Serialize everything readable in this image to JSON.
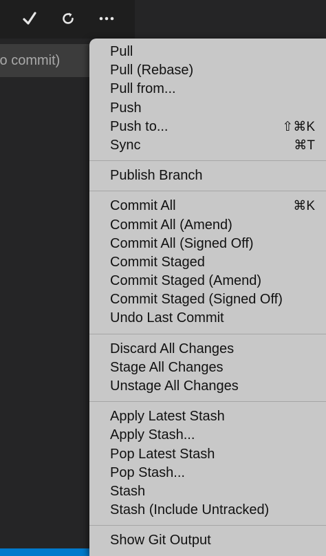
{
  "toolbar": {
    "commit_icon": "checkmark-icon",
    "refresh_icon": "refresh-icon",
    "more_icon": "ellipsis-icon"
  },
  "commit_input": {
    "placeholder_fragment": "to commit)"
  },
  "menu": {
    "groups": [
      {
        "items": [
          {
            "label": "Pull",
            "shortcut": ""
          },
          {
            "label": "Pull (Rebase)",
            "shortcut": ""
          },
          {
            "label": "Pull from...",
            "shortcut": ""
          },
          {
            "label": "Push",
            "shortcut": ""
          },
          {
            "label": "Push to...",
            "shortcut": "⇧⌘K"
          },
          {
            "label": "Sync",
            "shortcut": "⌘T"
          }
        ]
      },
      {
        "items": [
          {
            "label": "Publish Branch",
            "shortcut": ""
          }
        ]
      },
      {
        "items": [
          {
            "label": "Commit All",
            "shortcut": "⌘K"
          },
          {
            "label": "Commit All (Amend)",
            "shortcut": ""
          },
          {
            "label": "Commit All (Signed Off)",
            "shortcut": ""
          },
          {
            "label": "Commit Staged",
            "shortcut": ""
          },
          {
            "label": "Commit Staged (Amend)",
            "shortcut": ""
          },
          {
            "label": "Commit Staged (Signed Off)",
            "shortcut": ""
          },
          {
            "label": "Undo Last Commit",
            "shortcut": ""
          }
        ]
      },
      {
        "items": [
          {
            "label": "Discard All Changes",
            "shortcut": ""
          },
          {
            "label": "Stage All Changes",
            "shortcut": ""
          },
          {
            "label": "Unstage All Changes",
            "shortcut": ""
          }
        ]
      },
      {
        "items": [
          {
            "label": "Apply Latest Stash",
            "shortcut": ""
          },
          {
            "label": "Apply Stash...",
            "shortcut": ""
          },
          {
            "label": "Pop Latest Stash",
            "shortcut": ""
          },
          {
            "label": "Pop Stash...",
            "shortcut": ""
          },
          {
            "label": "Stash",
            "shortcut": ""
          },
          {
            "label": "Stash (Include Untracked)",
            "shortcut": ""
          }
        ]
      },
      {
        "items": [
          {
            "label": "Show Git Output",
            "shortcut": ""
          }
        ]
      }
    ]
  },
  "colors": {
    "background": "#252526",
    "menu_background": "#c8c8c8",
    "accent": "#007acc"
  }
}
